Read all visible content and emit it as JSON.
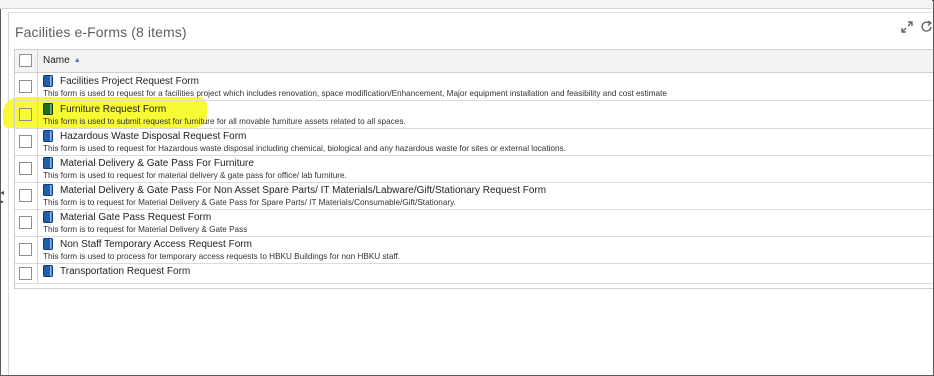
{
  "panel": {
    "title": "Facilities e-Forms (8 items)"
  },
  "grid": {
    "column_name": "Name",
    "sort_indicator": "▲",
    "rows": [
      {
        "title": "Facilities Project Request Form",
        "description": "This form is used to request for a facilities project which includes renovation, space modification/Enhancement, Major equipment installation and feasibility and cost estimate",
        "icon_color": "#1f5fae"
      },
      {
        "title": "Furniture Request Form",
        "description": "This form is used to submit request for furniture for all movable furniture assets related to all spaces.",
        "icon_color": "#1f6b1f"
      },
      {
        "title": "Hazardous Waste Disposal Request Form",
        "description": "This form is used to request for Hazardous waste disposal including chemical, biological and any hazardous waste for sites or external locations.",
        "icon_color": "#1f5fae"
      },
      {
        "title": "Material Delivery & Gate Pass For Furniture",
        "description": "This form is used to request for material delivery & gate pass for office/ lab furniture.",
        "icon_color": "#1f5fae"
      },
      {
        "title": "Material Delivery & Gate Pass For Non Asset Spare Parts/ IT Materials/Labware/Gift/Stationary Request Form",
        "description": "This form is to request for Material Delivery & Gate Pass for Spare Parts/ IT Materials/Consumable/Gift/Stationary.",
        "icon_color": "#1f5fae"
      },
      {
        "title": "Material Gate Pass Request Form",
        "description": "This form is to request for Material Delivery & Gate Pass",
        "icon_color": "#1f5fae"
      },
      {
        "title": "Non Staff Temporary Access Request Form",
        "description": "This form is used to process for temporary access requests to HBKU Buildings for non HBKU staff.",
        "icon_color": "#1f5fae"
      },
      {
        "title": "Transportation Request Form",
        "description": "",
        "icon_color": "#1f5fae"
      }
    ]
  },
  "highlight_color": "#f7f91a"
}
